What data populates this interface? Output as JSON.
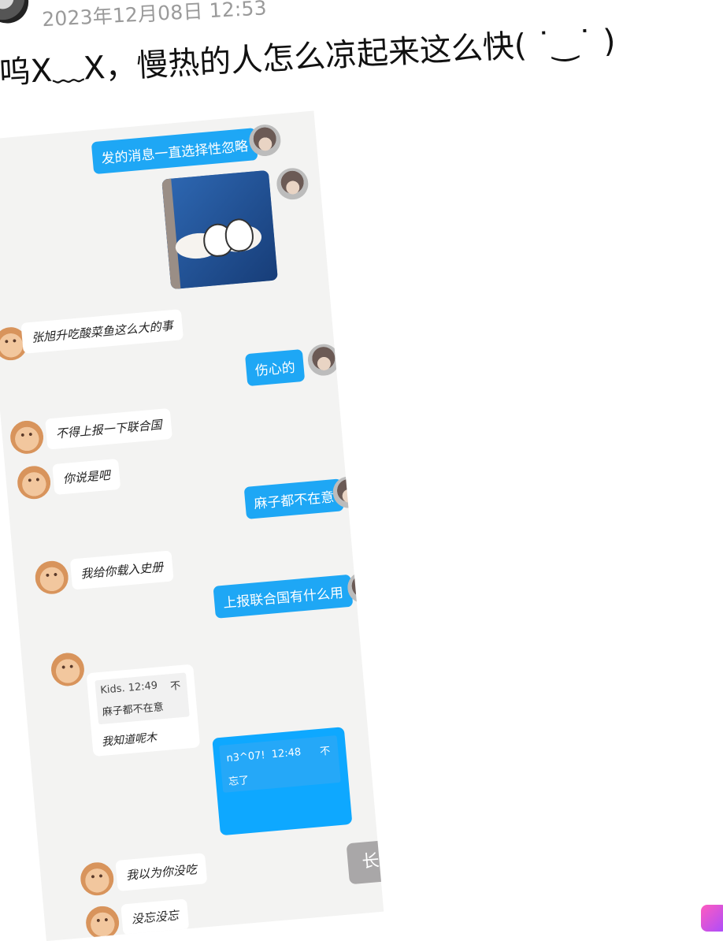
{
  "post": {
    "date": "2023年12月08日 12:53",
    "title": "呜X﹏X，慢热的人怎么凉起来这么快( ˙‿˙ )"
  },
  "chat": {
    "messages": [
      {
        "from": "me",
        "text": "发的消息一直选择性忽略"
      },
      {
        "from": "me",
        "type": "image",
        "desc": "cartoon-sticker-icon"
      },
      {
        "from": "other",
        "text": "张旭升吃酸菜鱼这么大的事"
      },
      {
        "from": "me",
        "text": "伤心的"
      },
      {
        "from": "other",
        "text": "不得上报一下联合国"
      },
      {
        "from": "other",
        "text": "你说是吧"
      },
      {
        "from": "me",
        "text": "麻子都不在意"
      },
      {
        "from": "other",
        "text": "我给你载入史册"
      },
      {
        "from": "me",
        "text": "上报联合国有什么用"
      },
      {
        "from": "other",
        "type": "quote",
        "quote_author": "Kids.",
        "quote_time": "12:49",
        "quote_text": "麻子都不在意",
        "reply": "我知道呢木"
      },
      {
        "from": "me",
        "type": "quote",
        "quote_author": "n3^07!",
        "quote_time": "12:48",
        "quote_text": "忘了",
        "reply": ""
      },
      {
        "from": "other",
        "text": "我以为你没吃"
      },
      {
        "from": "other",
        "text": "没忘没忘"
      }
    ],
    "quote_up_glyph": "不",
    "long_image_label": "长图"
  },
  "colors": {
    "my_bubble": "#1ea7f5",
    "chat_bg": "#f3f3f2",
    "long_btn": "#a9a7a8"
  }
}
